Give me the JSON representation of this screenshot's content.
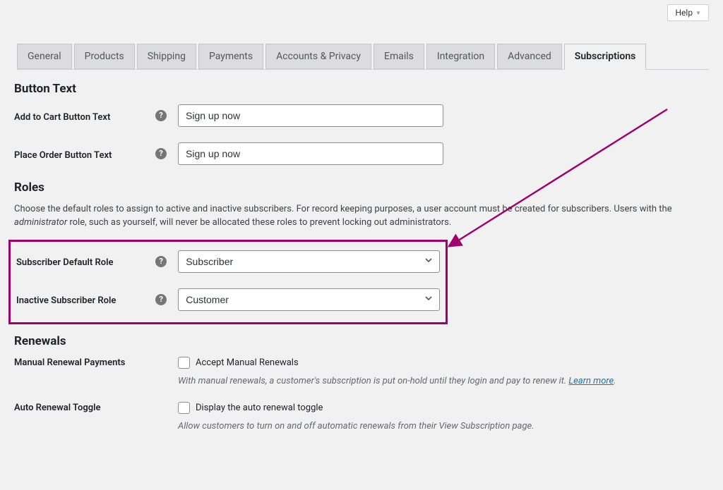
{
  "help_label": "Help",
  "tabs": {
    "general": "General",
    "products": "Products",
    "shipping": "Shipping",
    "payments": "Payments",
    "accounts": "Accounts & Privacy",
    "emails": "Emails",
    "integration": "Integration",
    "advanced": "Advanced",
    "subscriptions": "Subscriptions"
  },
  "section_button_text": "Button Text",
  "add_to_cart_label": "Add to Cart Button Text",
  "add_to_cart_value": "Sign up now",
  "place_order_label": "Place Order Button Text",
  "place_order_value": "Sign up now",
  "section_roles": "Roles",
  "roles_desc_a": "Choose the default roles to assign to active and inactive subscribers. For record keeping purposes, a user account must be created for subscribers. Users with the ",
  "roles_desc_em": "administrator",
  "roles_desc_b": " role, such as yourself, will never be allocated these roles to prevent locking out administrators.",
  "subscriber_default_label": "Subscriber Default Role",
  "subscriber_default_value": "Subscriber",
  "inactive_subscriber_label": "Inactive Subscriber Role",
  "inactive_subscriber_value": "Customer",
  "section_renewals": "Renewals",
  "manual_renewal_label": "Manual Renewal Payments",
  "manual_renewal_check": "Accept Manual Renewals",
  "manual_renewal_desc": "With manual renewals, a customer's subscription is put on-hold until they login and pay to renew it. ",
  "learn_more": "Learn more",
  "period": ".",
  "auto_toggle_label": "Auto Renewal Toggle",
  "auto_toggle_check": "Display the auto renewal toggle",
  "auto_toggle_desc": "Allow customers to turn on and off automatic renewals from their View Subscription page."
}
